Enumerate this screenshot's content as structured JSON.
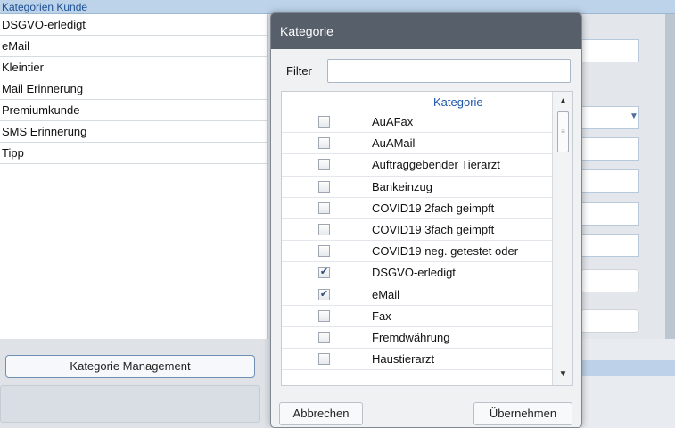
{
  "background": {
    "header_title": "Kategorien Kunde",
    "categories": [
      "DSGVO-erledigt",
      "eMail",
      "Kleintier",
      "Mail Erinnerung",
      "Premiumkunde",
      "SMS Erinnerung",
      "Tipp"
    ],
    "management_button_label": "Kategorie Management"
  },
  "dialog": {
    "title": "Kategorie",
    "filter_label": "Filter",
    "filter_value": "",
    "column_header": "Kategorie",
    "rows": [
      {
        "label": "AuAFax",
        "checked": false
      },
      {
        "label": "AuAMail",
        "checked": false
      },
      {
        "label": "Auftraggebender Tierarzt",
        "checked": false
      },
      {
        "label": "Bankeinzug",
        "checked": false
      },
      {
        "label": "COVID19 2fach geimpft",
        "checked": false
      },
      {
        "label": "COVID19 3fach geimpft",
        "checked": false
      },
      {
        "label": "COVID19 neg. getestet oder",
        "checked": false
      },
      {
        "label": "DSGVO-erledigt",
        "checked": true
      },
      {
        "label": "eMail",
        "checked": true
      },
      {
        "label": "Fax",
        "checked": false
      },
      {
        "label": "Fremdwährung",
        "checked": false
      },
      {
        "label": "Haustierarzt",
        "checked": false
      }
    ],
    "cancel_label": "Abbrechen",
    "apply_label": "Übernehmen"
  },
  "icons": {
    "scroll_up": "scroll-up-arrow-icon",
    "scroll_down": "scroll-down-arrow-icon",
    "dropdown": "chevron-down-icon",
    "checkmark": "checkmark-icon"
  },
  "colors": {
    "titlebar": "#575f6a",
    "header_accent": "#1d56a8",
    "background_header": "#bcd3ea"
  }
}
